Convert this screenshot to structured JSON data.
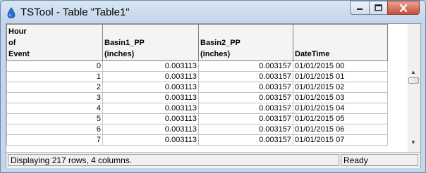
{
  "window": {
    "title": "TSTool - Table \"Table1\""
  },
  "table": {
    "columns": [
      "Hour\nof\nEvent",
      "Basin1_PP\n(inches)",
      "Basin2_PP\n(inches)",
      "DateTime"
    ],
    "rows": [
      [
        "0",
        "0.003113",
        "0.003157",
        "01/01/2015 00"
      ],
      [
        "1",
        "0.003113",
        "0.003157",
        "01/01/2015 01"
      ],
      [
        "2",
        "0.003113",
        "0.003157",
        "01/01/2015 02"
      ],
      [
        "3",
        "0.003113",
        "0.003157",
        "01/01/2015 03"
      ],
      [
        "4",
        "0.003113",
        "0.003157",
        "01/01/2015 04"
      ],
      [
        "5",
        "0.003113",
        "0.003157",
        "01/01/2015 05"
      ],
      [
        "6",
        "0.003113",
        "0.003157",
        "01/01/2015 06"
      ],
      [
        "7",
        "0.003113",
        "0.003157",
        "01/01/2015 07"
      ]
    ]
  },
  "status": {
    "message": "Displaying 217 rows, 4 columns.",
    "state": "Ready"
  },
  "icons": {
    "app": "water-drop-icon",
    "minimize": "minimize-icon",
    "maximize": "maximize-icon",
    "close": "close-icon"
  },
  "colors": {
    "title_bar": "#c4d6ea",
    "close_button": "#c8503a"
  }
}
